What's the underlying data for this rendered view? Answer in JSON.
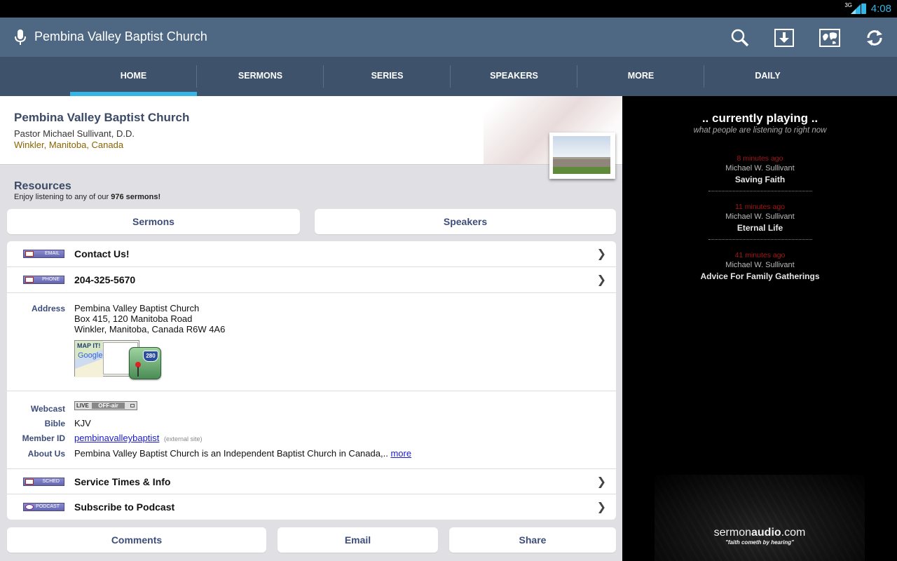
{
  "status_bar": {
    "network": "3G",
    "time": "4:08"
  },
  "action_bar": {
    "title": "Pembina Valley Baptist Church",
    "icons": [
      "mic-icon",
      "search-icon",
      "download-icon",
      "map-icon",
      "refresh-icon"
    ]
  },
  "tabs": [
    {
      "label": "HOME",
      "active": true
    },
    {
      "label": "SERMONS",
      "active": false
    },
    {
      "label": "SERIES",
      "active": false
    },
    {
      "label": "SPEAKERS",
      "active": false
    },
    {
      "label": "MORE",
      "active": false
    },
    {
      "label": "DAILY",
      "active": false
    }
  ],
  "header": {
    "church_name": "Pembina Valley Baptist Church",
    "pastor": "Pastor Michael Sullivant, D.D.",
    "location": "Winkler, Manitoba, Canada"
  },
  "resources": {
    "heading": "Resources",
    "subtitle_prefix": "Enjoy listening to any of our ",
    "subtitle_count": "976 sermons!",
    "sermons_button": "Sermons",
    "speakers_button": "Speakers"
  },
  "contact": {
    "email_badge": "EMAIL",
    "email_label": "Contact Us!",
    "phone_badge": "PHONE",
    "phone_label": "204-325-5670"
  },
  "address": {
    "label": "Address",
    "line1": "Pembina Valley Baptist Church",
    "line2": "Box 415, 120 Manitoba Road",
    "line3": "Winkler, Manitoba, Canada R6W 4A6",
    "map_text": "MAP IT!",
    "map_brand": "Google",
    "route_number": "280"
  },
  "details": {
    "webcast_label": "Webcast",
    "webcast_live": "LIVE",
    "webcast_status": "OFF-air",
    "bible_label": "Bible",
    "bible_value": "KJV",
    "member_label": "Member ID",
    "member_value": "pembinavalleybaptist",
    "member_note": "(external site)",
    "about_label": "About Us",
    "about_value": "Pembina Valley Baptist Church is an Independent Baptist Church in Canada,..",
    "about_more": "more"
  },
  "links": {
    "sched_badge": "SCHED",
    "sched_label": "Service Times & Info",
    "podcast_badge": "PODCAST",
    "podcast_label": "Subscribe to Podcast"
  },
  "bottom_buttons": {
    "comments": "Comments",
    "email": "Email",
    "share": "Share"
  },
  "now_playing": {
    "heading": ".. currently playing ..",
    "subheading": "what people are listening to right now",
    "items": [
      {
        "ago": "8 minutes ago",
        "speaker": "Michael W. Sullivant",
        "title": "Saving Faith"
      },
      {
        "ago": "11 minutes ago",
        "speaker": "Michael W. Sullivant",
        "title": "Eternal Life"
      },
      {
        "ago": "41 minutes ago",
        "speaker": "Michael W. Sullivant",
        "title": "Advice For Family Gatherings"
      }
    ]
  },
  "logo": {
    "brand_light": "sermon",
    "brand_bold": "audio",
    "brand_suffix": ".com",
    "tagline": "\"faith cometh by hearing\""
  },
  "colors": {
    "action_bar": "#4e6783",
    "tab_bar": "#3e536b",
    "tab_indicator": "#33b5e5",
    "heading": "#3b4a66",
    "timestamp": "#a21818"
  }
}
